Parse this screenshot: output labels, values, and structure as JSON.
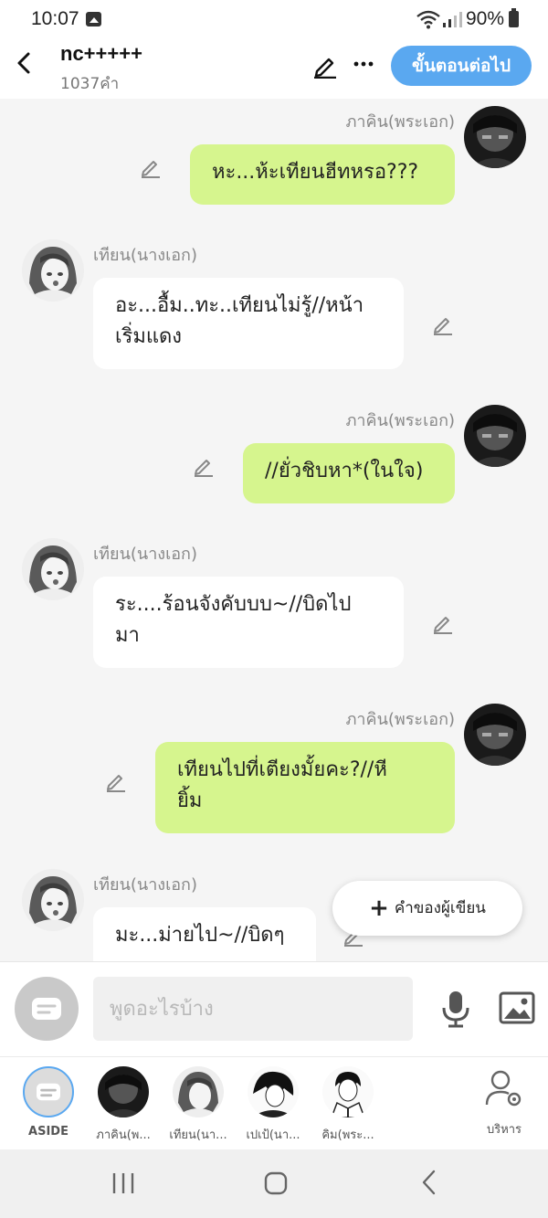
{
  "status_bar": {
    "time": "10:07",
    "battery": "90%"
  },
  "header": {
    "title": "nc+++++",
    "word_count": "1037คำ",
    "next_button": "ขั้นตอนต่อไป"
  },
  "messages": [
    {
      "side": "right",
      "name": "ภาคิน(พระเอก)",
      "lines": [
        "หะ...ห้ะเทียนฮีทหรอ???"
      ]
    },
    {
      "side": "left",
      "name": "เทียน(นางเอก)",
      "lines": [
        "อะ...อื้ม..ทะ..เทียนไม่รู้//หน้า",
        "เริ่มแดง"
      ]
    },
    {
      "side": "right",
      "name": "ภาคิน(พระเอก)",
      "lines": [
        "//ยั่วชิบหา*(ในใจ)"
      ]
    },
    {
      "side": "left",
      "name": "เทียน(นางเอก)",
      "lines": [
        "ระ....ร้อนจังคับบบ~//บิดไป",
        "มา"
      ]
    },
    {
      "side": "right",
      "name": "ภาคิน(พระเอก)",
      "lines": [
        "เทียนไปที่เตียงมั้ยคะ?//หี",
        "ยิ้ม"
      ]
    },
    {
      "side": "left",
      "name": "เทียน(นางเอก)",
      "lines": [
        "มะ...ม่ายไป~//บิดๆ"
      ]
    }
  ],
  "fab": {
    "label": "คำของผู้เขียน"
  },
  "input": {
    "placeholder": "พูดอะไรบ้าง"
  },
  "characters": [
    {
      "label": "ASIDE"
    },
    {
      "label": "ภาคิน(พ..."
    },
    {
      "label": "เทียน(นา..."
    },
    {
      "label": "เปเป้(นา..."
    },
    {
      "label": "คิม(พระ..."
    }
  ],
  "manage": {
    "label": "บริหาร"
  },
  "colors": {
    "accent": "#5aa8f0",
    "hero_bubble": "#d6f58e",
    "heroine_bubble": "#ffffff",
    "background": "#f5f5f5"
  }
}
